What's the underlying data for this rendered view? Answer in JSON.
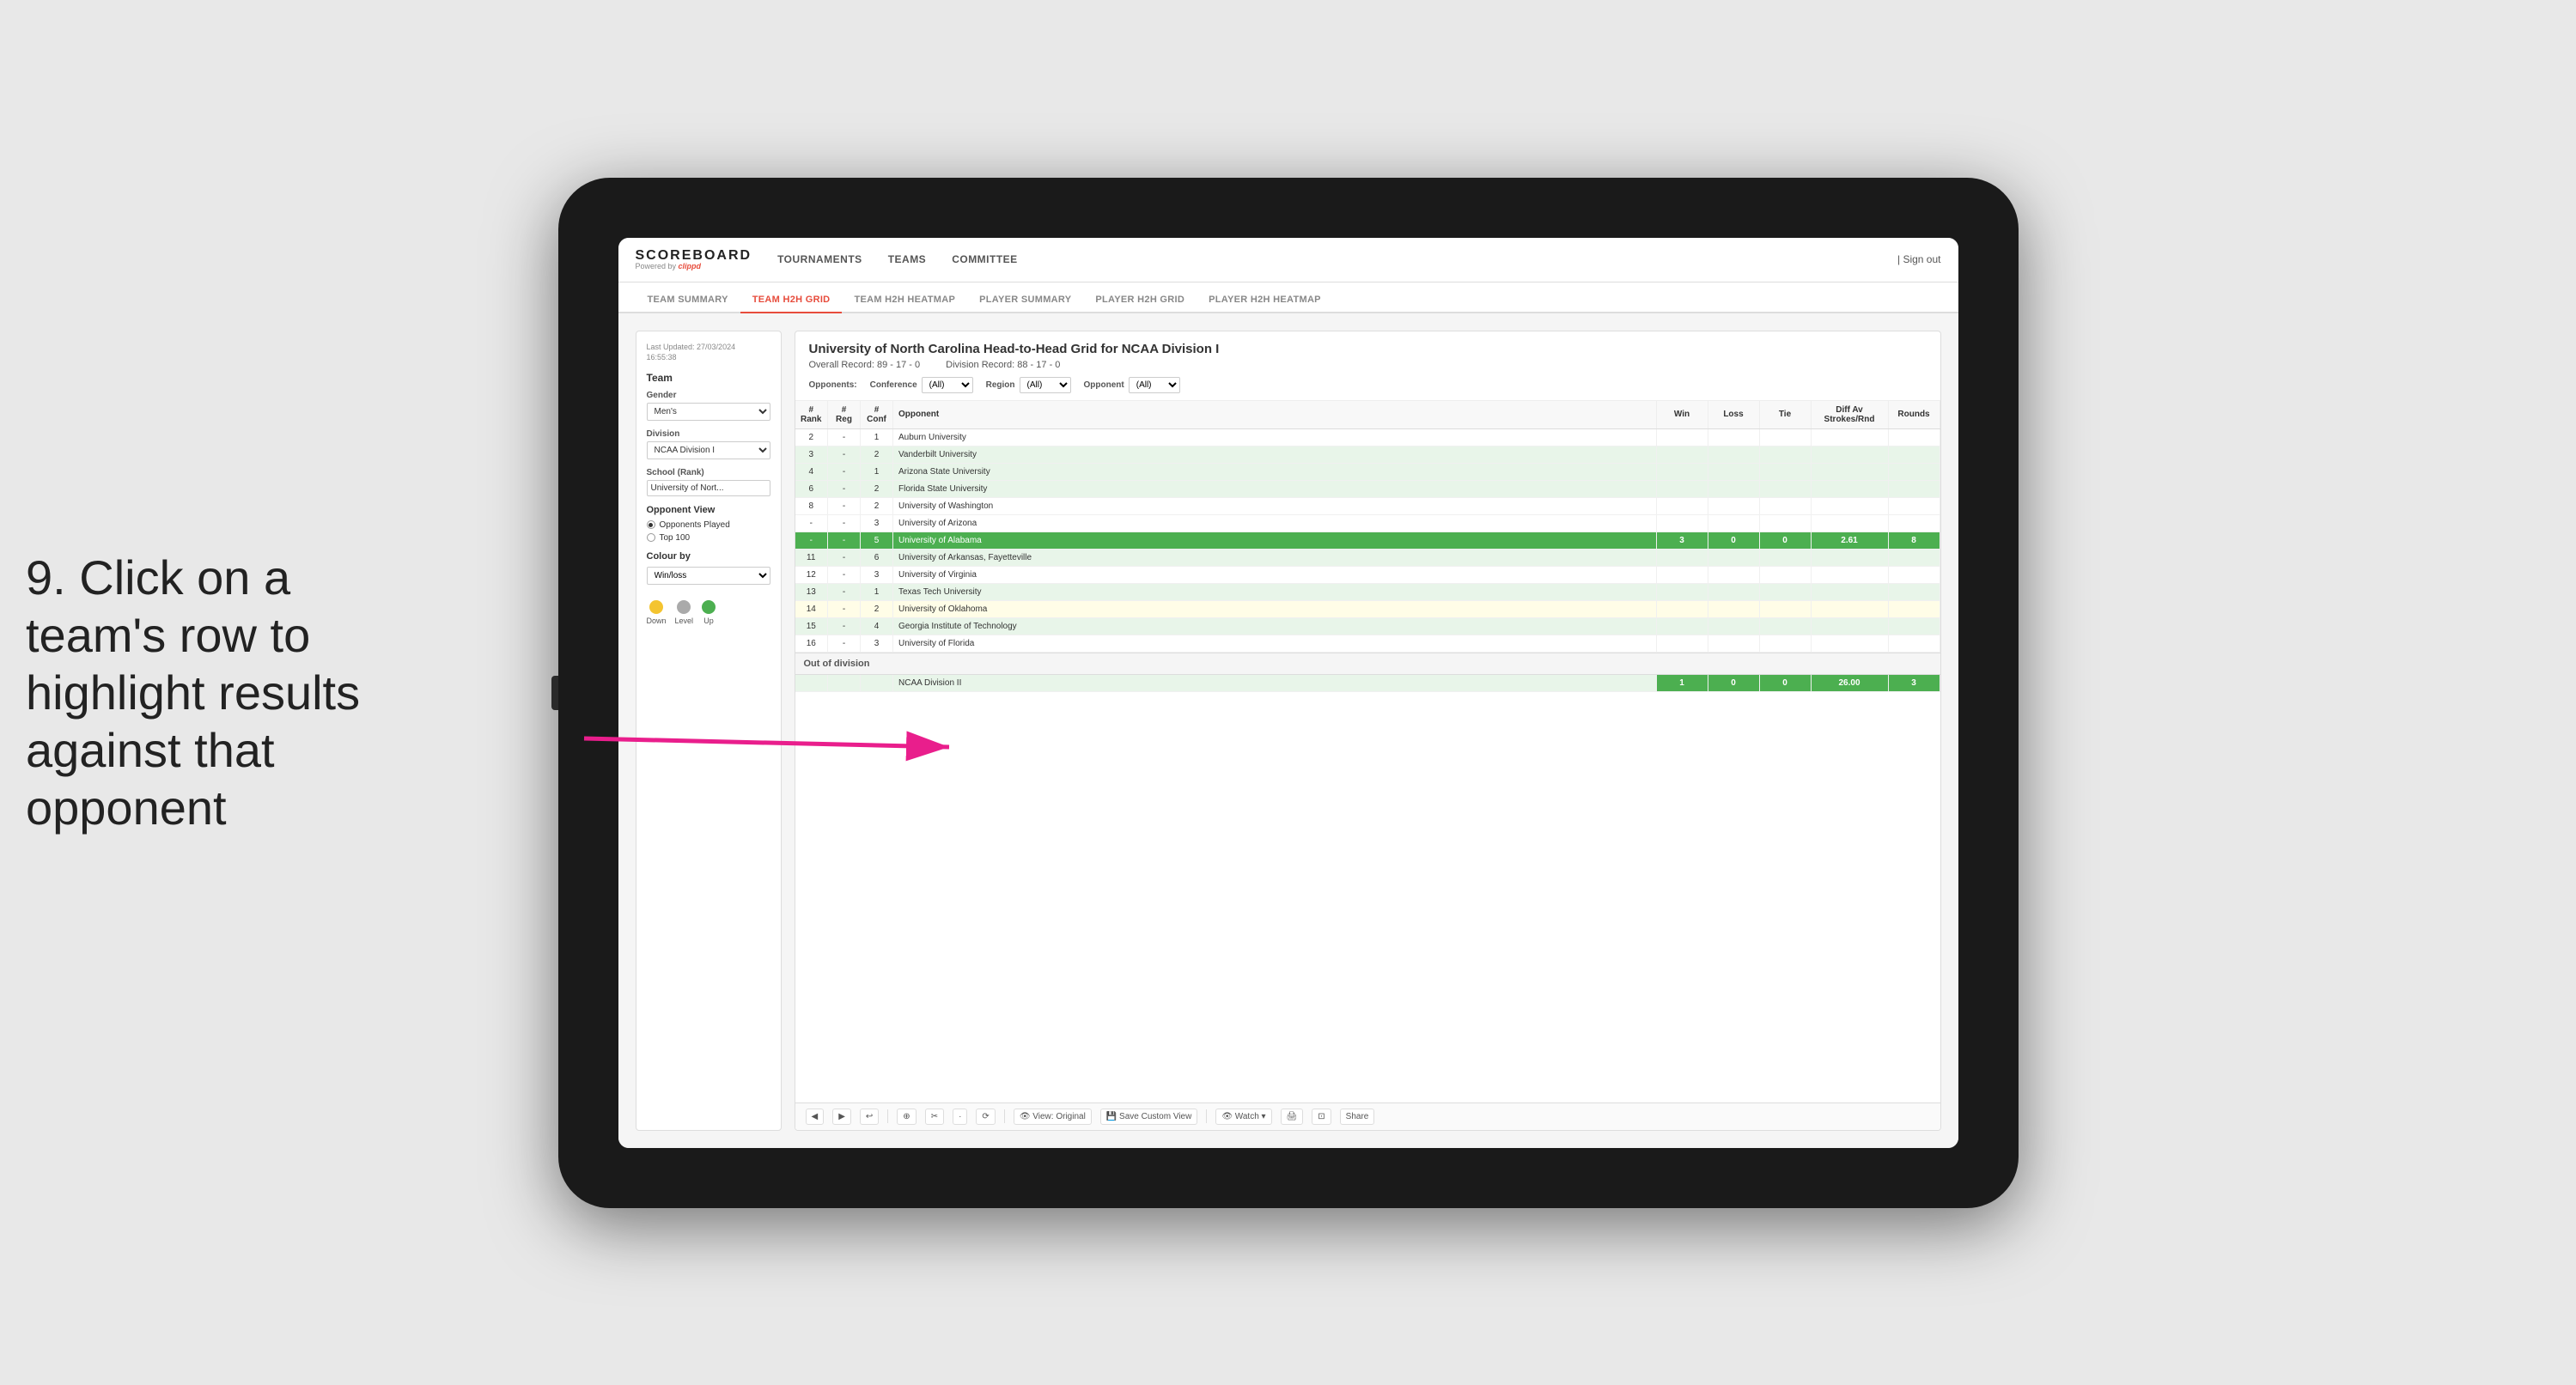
{
  "annotation": {
    "text": "9. Click on a team's row to highlight results against that opponent"
  },
  "nav": {
    "logo": "SCOREBOARD",
    "logo_sub": "Powered by",
    "logo_brand": "clippd",
    "links": [
      "TOURNAMENTS",
      "TEAMS",
      "COMMITTEE"
    ],
    "sign_out": "Sign out"
  },
  "sub_nav": {
    "items": [
      "TEAM SUMMARY",
      "TEAM H2H GRID",
      "TEAM H2H HEATMAP",
      "PLAYER SUMMARY",
      "PLAYER H2H GRID",
      "PLAYER H2H HEATMAP"
    ],
    "active": "TEAM H2H GRID"
  },
  "sidebar": {
    "timestamp_label": "Last Updated: 27/03/2024",
    "timestamp_time": "16:55:38",
    "team_label": "Team",
    "gender_label": "Gender",
    "gender_value": "Men's",
    "division_label": "Division",
    "division_value": "NCAA Division I",
    "school_label": "School (Rank)",
    "school_value": "University of Nort...",
    "opponent_view_label": "Opponent View",
    "radio1": "Opponents Played",
    "radio2": "Top 100",
    "colour_by_label": "Colour by",
    "colour_by_value": "Win/loss",
    "legend": [
      {
        "label": "Down",
        "color": "#f4c430"
      },
      {
        "label": "Level",
        "color": "#aaa"
      },
      {
        "label": "Up",
        "color": "#4caf50"
      }
    ]
  },
  "scoreboard": {
    "title": "University of North Carolina Head-to-Head Grid for NCAA Division I",
    "overall_record": "Overall Record: 89 - 17 - 0",
    "division_record": "Division Record: 88 - 17 - 0",
    "filters": {
      "opponents_label": "Opponents:",
      "conference_label": "Conference",
      "conference_value": "(All)",
      "region_label": "Region",
      "region_value": "(All)",
      "opponent_label": "Opponent",
      "opponent_value": "(All)"
    },
    "table_headers": [
      "#\nRank",
      "#\nReg",
      "#\nConf",
      "Opponent",
      "Win",
      "Loss",
      "Tie",
      "Diff Av\nStrokes/Rnd",
      "Rounds"
    ],
    "rows": [
      {
        "rank": "2",
        "reg": "-",
        "conf": "1",
        "opponent": "Auburn University",
        "win": "",
        "loss": "",
        "tie": "",
        "diff": "",
        "rounds": "",
        "style": "normal"
      },
      {
        "rank": "3",
        "reg": "-",
        "conf": "2",
        "opponent": "Vanderbilt University",
        "win": "",
        "loss": "",
        "tie": "",
        "diff": "",
        "rounds": "",
        "style": "light-green"
      },
      {
        "rank": "4",
        "reg": "-",
        "conf": "1",
        "opponent": "Arizona State University",
        "win": "",
        "loss": "",
        "tie": "",
        "diff": "",
        "rounds": "",
        "style": "light-green"
      },
      {
        "rank": "6",
        "reg": "-",
        "conf": "2",
        "opponent": "Florida State University",
        "win": "",
        "loss": "",
        "tie": "",
        "diff": "",
        "rounds": "",
        "style": "light-green"
      },
      {
        "rank": "8",
        "reg": "-",
        "conf": "2",
        "opponent": "University of Washington",
        "win": "",
        "loss": "",
        "tie": "",
        "diff": "",
        "rounds": "",
        "style": "normal"
      },
      {
        "rank": "-",
        "reg": "-",
        "conf": "3",
        "opponent": "University of Arizona",
        "win": "",
        "loss": "",
        "tie": "",
        "diff": "",
        "rounds": "",
        "style": "normal"
      },
      {
        "rank": "-",
        "reg": "-",
        "conf": "5",
        "opponent": "University of Alabama",
        "win": "3",
        "loss": "0",
        "tie": "0",
        "diff": "2.61",
        "rounds": "8",
        "style": "highlighted"
      },
      {
        "rank": "11",
        "reg": "-",
        "conf": "6",
        "opponent": "University of Arkansas, Fayetteville",
        "win": "",
        "loss": "",
        "tie": "",
        "diff": "",
        "rounds": "",
        "style": "light-green"
      },
      {
        "rank": "12",
        "reg": "-",
        "conf": "3",
        "opponent": "University of Virginia",
        "win": "",
        "loss": "",
        "tie": "",
        "diff": "",
        "rounds": "",
        "style": "normal"
      },
      {
        "rank": "13",
        "reg": "-",
        "conf": "1",
        "opponent": "Texas Tech University",
        "win": "",
        "loss": "",
        "tie": "",
        "diff": "",
        "rounds": "",
        "style": "light-green"
      },
      {
        "rank": "14",
        "reg": "-",
        "conf": "2",
        "opponent": "University of Oklahoma",
        "win": "",
        "loss": "",
        "tie": "",
        "diff": "",
        "rounds": "",
        "style": "light-yellow"
      },
      {
        "rank": "15",
        "reg": "-",
        "conf": "4",
        "opponent": "Georgia Institute of Technology",
        "win": "",
        "loss": "",
        "tie": "",
        "diff": "",
        "rounds": "",
        "style": "light-green"
      },
      {
        "rank": "16",
        "reg": "-",
        "conf": "3",
        "opponent": "University of Florida",
        "win": "",
        "loss": "",
        "tie": "",
        "diff": "",
        "rounds": "",
        "style": "normal"
      }
    ],
    "out_of_division_label": "Out of division",
    "out_of_division_row": {
      "division": "NCAA Division II",
      "win": "1",
      "loss": "0",
      "tie": "0",
      "diff": "26.00",
      "rounds": "3"
    }
  },
  "toolbar": {
    "buttons": [
      "◀",
      "▶",
      "↩",
      "⊕",
      "✂",
      "·",
      "⟳",
      "👁 View: Original",
      "💾 Save Custom View",
      "👁 Watch ▾",
      "🖨",
      "⊡",
      "Share"
    ]
  }
}
